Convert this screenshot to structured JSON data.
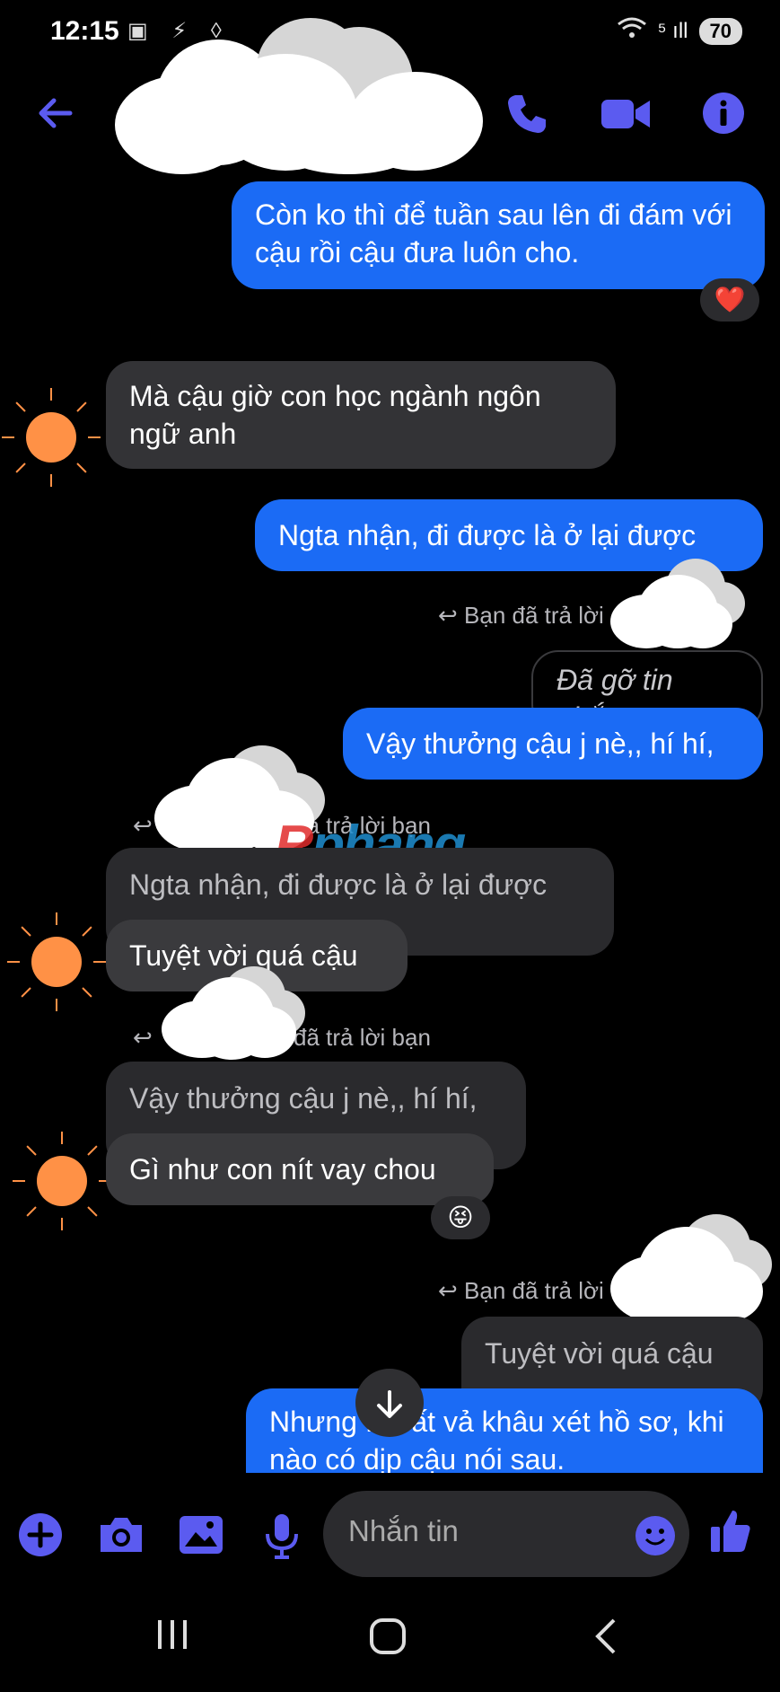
{
  "status_bar": {
    "time": "12:15",
    "battery": "70",
    "left_icons": "▣ ⚡ ◊",
    "signal": "⁵ ıll"
  },
  "header": {
    "contact_name": ""
  },
  "messages": {
    "m1": {
      "text": "Còn ko thì để tuần sau lên đi đám với cậu rồi cậu đưa luôn cho.",
      "reaction": "❤️"
    },
    "m2": {
      "text": "Mà cậu giờ con học ngành ngôn ngữ anh"
    },
    "m3": {
      "text": "Ngta nhận, đi được là ở lại được"
    },
    "reply1_label": "Bạn đã trả lời",
    "m4_quote": {
      "text": "Đã gỡ tin nhắn"
    },
    "m4": {
      "text": "Vậy thưởng cậu j nè,, hí hí,"
    },
    "reply2_label": "đã trả lời bạn",
    "m5_quote": {
      "text": "Ngta nhận, đi được là ở lại được"
    },
    "m5": {
      "text": "Tuyệt vời quá cậu"
    },
    "reply3_label": "đã trả lời bạn",
    "m6_quote": {
      "text": "Vậy thưởng cậu j nè,, hí hí,"
    },
    "m6": {
      "text": "Gì như con nít vay chou",
      "reaction": "😝"
    },
    "reply4_label": "Bạn đã trả lời",
    "m7_quote": {
      "text": "Tuyệt vời quá cậu"
    },
    "m7": {
      "text": "Nhưng ... vất vả khâu xét hồ sơ, khi nào có dịp cậu nói sau."
    }
  },
  "watermark": {
    "prefix": "R",
    "rest": "phang"
  },
  "composer": {
    "placeholder": "Nhắn tin"
  },
  "colors": {
    "accent": "#5b5bf0",
    "out_bubble": "#1b6bf5",
    "in_bubble": "#333336",
    "sun": "#ff9146"
  },
  "icons": [
    "back-arrow-icon",
    "phone-icon",
    "video-icon",
    "info-icon",
    "plus-icon",
    "camera-icon",
    "image-icon",
    "mic-icon",
    "emoji-icon",
    "like-icon",
    "arrow-down-icon",
    "recents-icon",
    "home-icon",
    "nav-back-icon"
  ]
}
